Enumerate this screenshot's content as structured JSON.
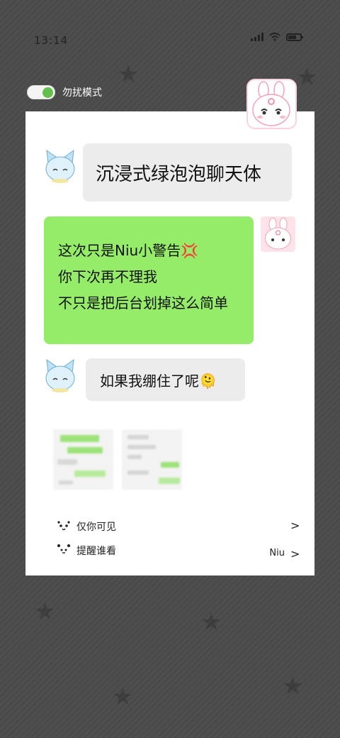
{
  "status_bar": {
    "time": "13:14",
    "battery": "battery-icon",
    "signal": "signal-icon",
    "wifi": "wifi-icon"
  },
  "toggle": {
    "label": "勿扰模式",
    "state": "on",
    "color": "#63c04d"
  },
  "messages": [
    {
      "side": "left",
      "avatar": "blue-cat-avatar",
      "text": "沉浸式绿泡泡聊天体"
    },
    {
      "side": "right",
      "avatar": "pink-bunny-avatar",
      "lines": [
        "这次只是Niu小警告💢",
        "你下次再不理我",
        "不只是把后台划掉这么简单"
      ]
    },
    {
      "side": "left",
      "avatar": "blue-cat-avatar",
      "text": "如果我绷住了呢🫠"
    }
  ],
  "options": [
    {
      "icon": "eye-face-icon",
      "label": "仅你可见",
      "value": ""
    },
    {
      "icon": "bear-face-icon",
      "label": "提醒谁看",
      "value": "Niu"
    }
  ],
  "colors": {
    "bubble_green": "#95ec69",
    "bubble_gray": "#ececec",
    "background": "#4a4a4a"
  }
}
